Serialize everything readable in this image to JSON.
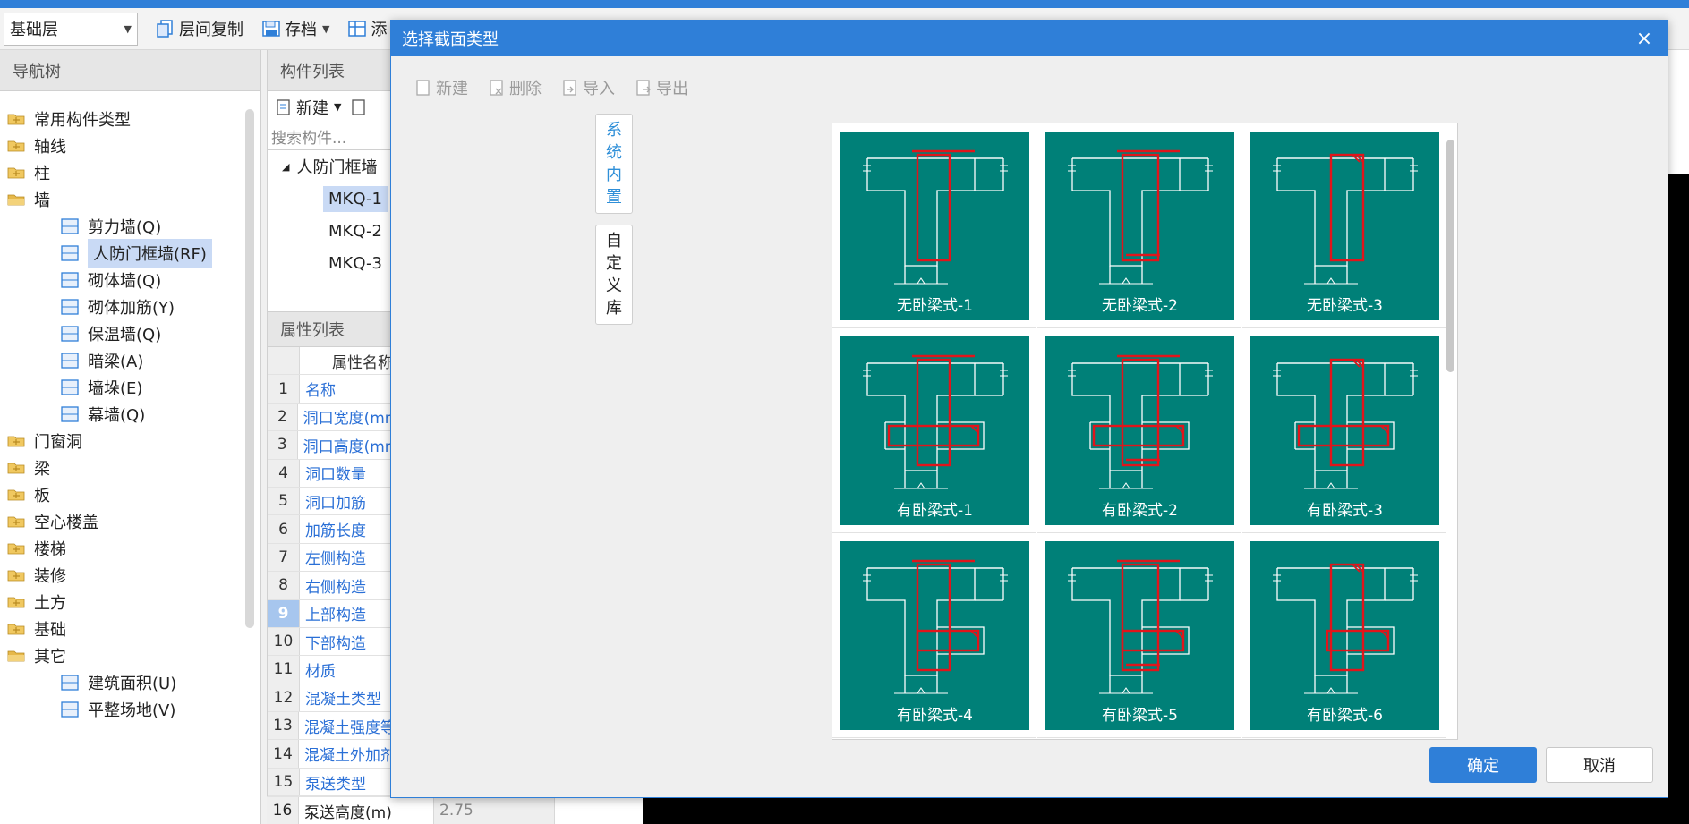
{
  "toolbar": {
    "layer_value": "基础层",
    "copy_label": "层间复制",
    "archive_label": "存档",
    "add_label": "添"
  },
  "nav": {
    "header": "导航树",
    "items": [
      {
        "label": "常用构件类型",
        "type": "folder",
        "icon": "folder-icon"
      },
      {
        "label": "轴线",
        "type": "folder",
        "icon": "folder-icon"
      },
      {
        "label": "柱",
        "type": "folder",
        "icon": "folder-icon"
      },
      {
        "label": "墙",
        "type": "folder-open",
        "icon": "folder-open-icon"
      },
      {
        "label": "剪力墙(Q)",
        "type": "child",
        "icon": "shear-wall-icon"
      },
      {
        "label": "人防门框墙(RF)",
        "type": "child",
        "icon": "door-frame-wall-icon",
        "selected": true
      },
      {
        "label": "砌体墙(Q)",
        "type": "child",
        "icon": "masonry-wall-icon"
      },
      {
        "label": "砌体加筋(Y)",
        "type": "child",
        "icon": "masonry-rebar-icon"
      },
      {
        "label": "保温墙(Q)",
        "type": "child",
        "icon": "insulation-wall-icon"
      },
      {
        "label": "暗梁(A)",
        "type": "child",
        "icon": "hidden-beam-icon"
      },
      {
        "label": "墙垛(E)",
        "type": "child",
        "icon": "wall-pier-icon"
      },
      {
        "label": "幕墙(Q)",
        "type": "child",
        "icon": "curtain-wall-icon"
      },
      {
        "label": "门窗洞",
        "type": "folder",
        "icon": "folder-icon"
      },
      {
        "label": "梁",
        "type": "folder",
        "icon": "folder-icon"
      },
      {
        "label": "板",
        "type": "folder",
        "icon": "folder-icon"
      },
      {
        "label": "空心楼盖",
        "type": "folder",
        "icon": "folder-icon"
      },
      {
        "label": "楼梯",
        "type": "folder",
        "icon": "folder-icon"
      },
      {
        "label": "装修",
        "type": "folder",
        "icon": "folder-icon"
      },
      {
        "label": "土方",
        "type": "folder",
        "icon": "folder-icon"
      },
      {
        "label": "基础",
        "type": "folder",
        "icon": "folder-icon"
      },
      {
        "label": "其它",
        "type": "folder-open",
        "icon": "folder-open-icon"
      },
      {
        "label": "建筑面积(U)",
        "type": "child",
        "icon": "building-area-icon"
      },
      {
        "label": "平整场地(V)",
        "type": "child",
        "icon": "site-leveling-icon"
      }
    ]
  },
  "components": {
    "header": "构件列表",
    "new_label": "新建",
    "search_placeholder": "搜索构件...",
    "group": "人防门框墙",
    "items": [
      "MKQ-1",
      "MKQ-2",
      "MKQ-3"
    ]
  },
  "properties": {
    "header": "属性列表",
    "column_name": "属性名称",
    "rows": [
      {
        "idx": "1",
        "name": "名称"
      },
      {
        "idx": "2",
        "name": "洞口宽度(mm"
      },
      {
        "idx": "3",
        "name": "洞口高度(mm"
      },
      {
        "idx": "4",
        "name": "洞口数量"
      },
      {
        "idx": "5",
        "name": "洞口加筋"
      },
      {
        "idx": "6",
        "name": "加筋长度"
      },
      {
        "idx": "7",
        "name": "左侧构造"
      },
      {
        "idx": "8",
        "name": "右侧构造"
      },
      {
        "idx": "9",
        "name": "上部构造"
      },
      {
        "idx": "10",
        "name": "下部构造"
      },
      {
        "idx": "11",
        "name": "材质"
      },
      {
        "idx": "12",
        "name": "混凝土类型"
      },
      {
        "idx": "13",
        "name": "混凝土强度等"
      },
      {
        "idx": "14",
        "name": "混凝土外加剂"
      },
      {
        "idx": "15",
        "name": "泵送类型"
      }
    ],
    "last_row": {
      "idx": "16",
      "name": "泵送高度(m)",
      "value": "2.75"
    }
  },
  "dialog": {
    "title": "选择截面类型",
    "close_glyph": "×",
    "tools": [
      {
        "label": "新建",
        "icon": "new-doc-icon"
      },
      {
        "label": "删除",
        "icon": "delete-doc-icon"
      },
      {
        "label": "导入",
        "icon": "import-icon"
      },
      {
        "label": "导出",
        "icon": "export-icon"
      }
    ],
    "tab_system": [
      "系",
      "统",
      "内",
      "置"
    ],
    "tab_custom": [
      "自",
      "定",
      "义",
      "库"
    ],
    "sections": [
      {
        "label": "无卧梁式-1",
        "kind": "plain",
        "variant": 1
      },
      {
        "label": "无卧梁式-2",
        "kind": "plain",
        "variant": 2
      },
      {
        "label": "无卧梁式-3",
        "kind": "plain",
        "variant": 3
      },
      {
        "label": "有卧梁式-1",
        "kind": "cross",
        "variant": 1
      },
      {
        "label": "有卧梁式-2",
        "kind": "cross",
        "variant": 2
      },
      {
        "label": "有卧梁式-3",
        "kind": "cross",
        "variant": 3
      },
      {
        "label": "有卧梁式-4",
        "kind": "flag",
        "variant": 1
      },
      {
        "label": "有卧梁式-5",
        "kind": "flag",
        "variant": 2
      },
      {
        "label": "有卧梁式-6",
        "kind": "flag",
        "variant": 3
      }
    ],
    "ok_label": "确定",
    "cancel_label": "取消",
    "colors": {
      "tile": "#008078",
      "rebar": "#e0151b",
      "accent": "#2f7fd8"
    }
  }
}
